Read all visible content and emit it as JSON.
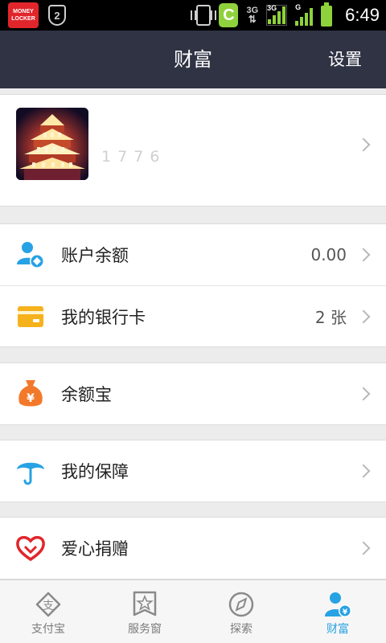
{
  "status_bar": {
    "money_locker_line1": "MONEY",
    "money_locker_line2": "LOCKER",
    "shield_badge": "2",
    "c_app_letter": "C",
    "net_type_1": "3G",
    "net_type_2": "3G",
    "net_type_3": "G",
    "time": "6:49",
    "icons": [
      "money-locker-icon",
      "shield-icon",
      "vibrate-icon",
      "c-app-icon",
      "data-transfer-icon",
      "signal-icon",
      "battery-icon"
    ]
  },
  "header": {
    "title": "财富",
    "settings_label": "设置"
  },
  "profile": {
    "name": "",
    "phone": "1  7     7  6",
    "avatar": "avatar-photo-tower"
  },
  "accounts": [
    {
      "id": "balance",
      "label": "账户余额",
      "value": "0.00",
      "icon": "user-balance-icon"
    },
    {
      "id": "bank-cards",
      "label": "我的银行卡",
      "value": "2 张",
      "icon": "bank-card-icon"
    }
  ],
  "yuebao": {
    "label": "余额宝",
    "icon": "yuebao-bag-icon"
  },
  "insurance": {
    "label": "我的保障",
    "icon": "umbrella-icon"
  },
  "charity": {
    "label": "爱心捐赠",
    "icon": "heart-icon"
  },
  "tabs": [
    {
      "id": "alipay",
      "label": "支付宝",
      "icon": "alipay-icon",
      "active": false
    },
    {
      "id": "service",
      "label": "服务窗",
      "icon": "star-window-icon",
      "active": false
    },
    {
      "id": "explore",
      "label": "探索",
      "icon": "compass-icon",
      "active": false
    },
    {
      "id": "wealth",
      "label": "财富",
      "icon": "wealth-user-icon",
      "active": true
    }
  ],
  "colors": {
    "header_bg": "#2f3344",
    "accent_blue": "#27a2e4",
    "card_yellow": "#f6b21c",
    "bag_orange": "#f3792a",
    "heart_red": "#e0262b",
    "page_bg": "#ececec"
  }
}
